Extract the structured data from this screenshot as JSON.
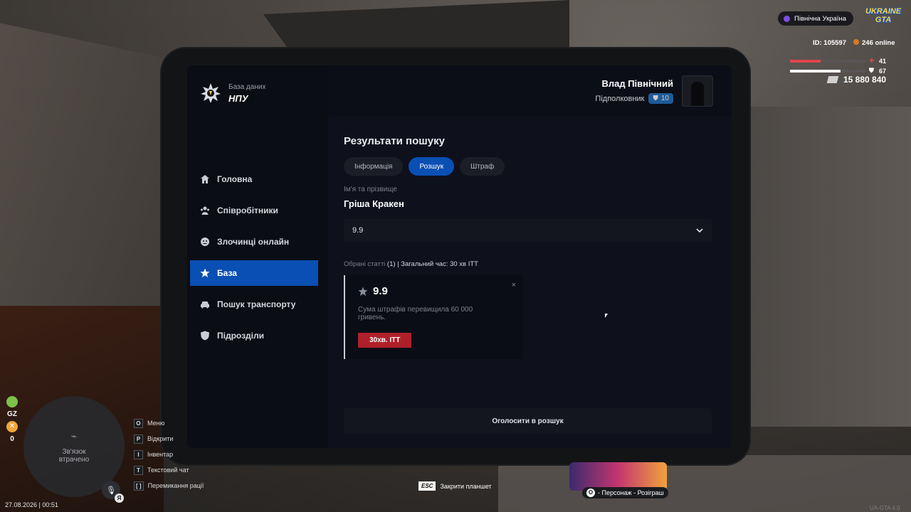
{
  "db_label": "База даних",
  "db_name": "НПУ",
  "nav": [
    {
      "label": "Головна",
      "icon": "home-icon"
    },
    {
      "label": "Співробітники",
      "icon": "people-icon"
    },
    {
      "label": "Злочинці онлайн",
      "icon": "criminal-icon"
    },
    {
      "label": "База",
      "icon": "star-icon",
      "active": true
    },
    {
      "label": "Пошук транспорту",
      "icon": "car-icon"
    },
    {
      "label": "Підрозділи",
      "icon": "shield-icon"
    }
  ],
  "user": {
    "name": "Влад Північний",
    "rank": "Підполковник",
    "badge": "10"
  },
  "search": {
    "title": "Результати пошуку",
    "tabs": [
      {
        "label": "Інформація",
        "active": false
      },
      {
        "label": "Розшук",
        "active": true
      },
      {
        "label": "Штраф",
        "active": false
      }
    ],
    "name_label": "Ім'я та прізвище",
    "name_value": "Гріша Кракен",
    "select_value": "9.9",
    "summary_prefix": "Обрані статті",
    "summary_value": "(1) | Загальний час: 30 хв ІТТ",
    "card": {
      "code": "9.9",
      "desc": "Сума штрафів перевищила 60 000 гривень.",
      "tag": "30хв. ІТТ",
      "close": "×"
    },
    "submit_label": "Оголосити в розшук"
  },
  "hud": {
    "server": "Північна Україна",
    "logo": "UKRAINE GTA",
    "id": "ID: 105597",
    "online": "246 online",
    "health": 41,
    "armor": 67,
    "money": "15 880 840",
    "gz": "GZ",
    "zero": "0",
    "map_text": "Зв'язок втрачено",
    "keys": [
      {
        "k": "O",
        "label": "Меню"
      },
      {
        "k": "P",
        "label": "Відкрити"
      },
      {
        "k": "I",
        "label": "Інвентар"
      },
      {
        "k": "T",
        "label": "Текстовий чат"
      },
      {
        "k": "[  ]",
        "label": "Перемикання рації"
      }
    ],
    "esc_key": "ESC",
    "esc_label": "Закрити планшет",
    "promo_key": "O",
    "promo_label": "- Персонаж - Розіграш",
    "datetime": "27.08.2026 | 00:51",
    "version": "UA-GTA 4.0",
    "mic_user": "Я"
  },
  "colors": {
    "accent": "#0a4fb3",
    "tag": "#b0202a",
    "health": "#e0454f",
    "armor": "#f2f2f2"
  }
}
